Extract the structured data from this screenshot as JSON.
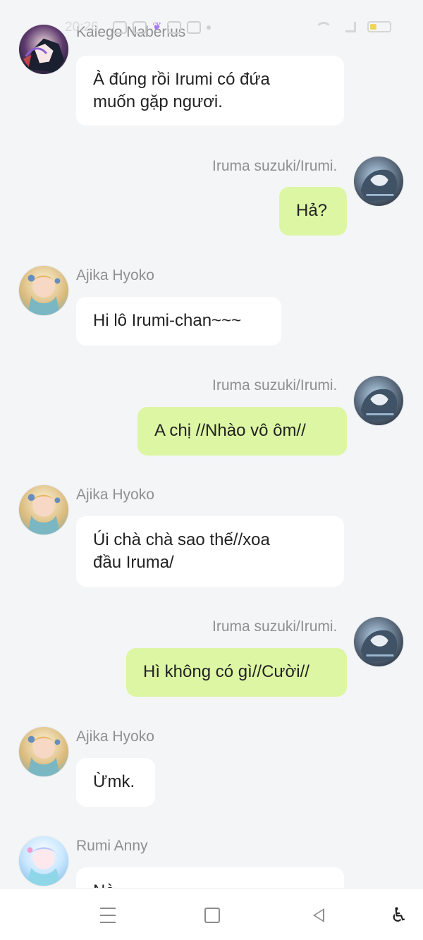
{
  "status_bar": {
    "time": "20:26"
  },
  "messages": [
    {
      "sender": "Kaiego Naberius",
      "text": "À đúng rồi Irumi có đứa\nmuốn gặp ngươi.",
      "direction": "incoming"
    },
    {
      "sender": "Iruma suzuki/Irumi.",
      "text": "Hả?",
      "direction": "outgoing"
    },
    {
      "sender": "Ajika Hyoko",
      "text": "Hi lô Irumi-chan~~~",
      "direction": "incoming"
    },
    {
      "sender": "Iruma suzuki/Irumi.",
      "text": "A chị //Nhào vô ôm//",
      "direction": "outgoing"
    },
    {
      "sender": "Ajika Hyoko",
      "text": "Úi chà chà sao thế//xoa\nđầu Iruma/",
      "direction": "incoming"
    },
    {
      "sender": "Iruma suzuki/Irumi.",
      "text": "Hì không có gì//Cười//",
      "direction": "outgoing"
    },
    {
      "sender": "Ajika Hyoko",
      "text": "Ừmk.",
      "direction": "incoming"
    },
    {
      "sender": "Rumi Anny",
      "text": "Nè...",
      "direction": "incoming"
    }
  ],
  "nav": {
    "menu_icon": "menu-icon",
    "home_icon": "home-icon",
    "back_icon": "back-icon",
    "accessibility_icon": "accessibility-icon"
  }
}
